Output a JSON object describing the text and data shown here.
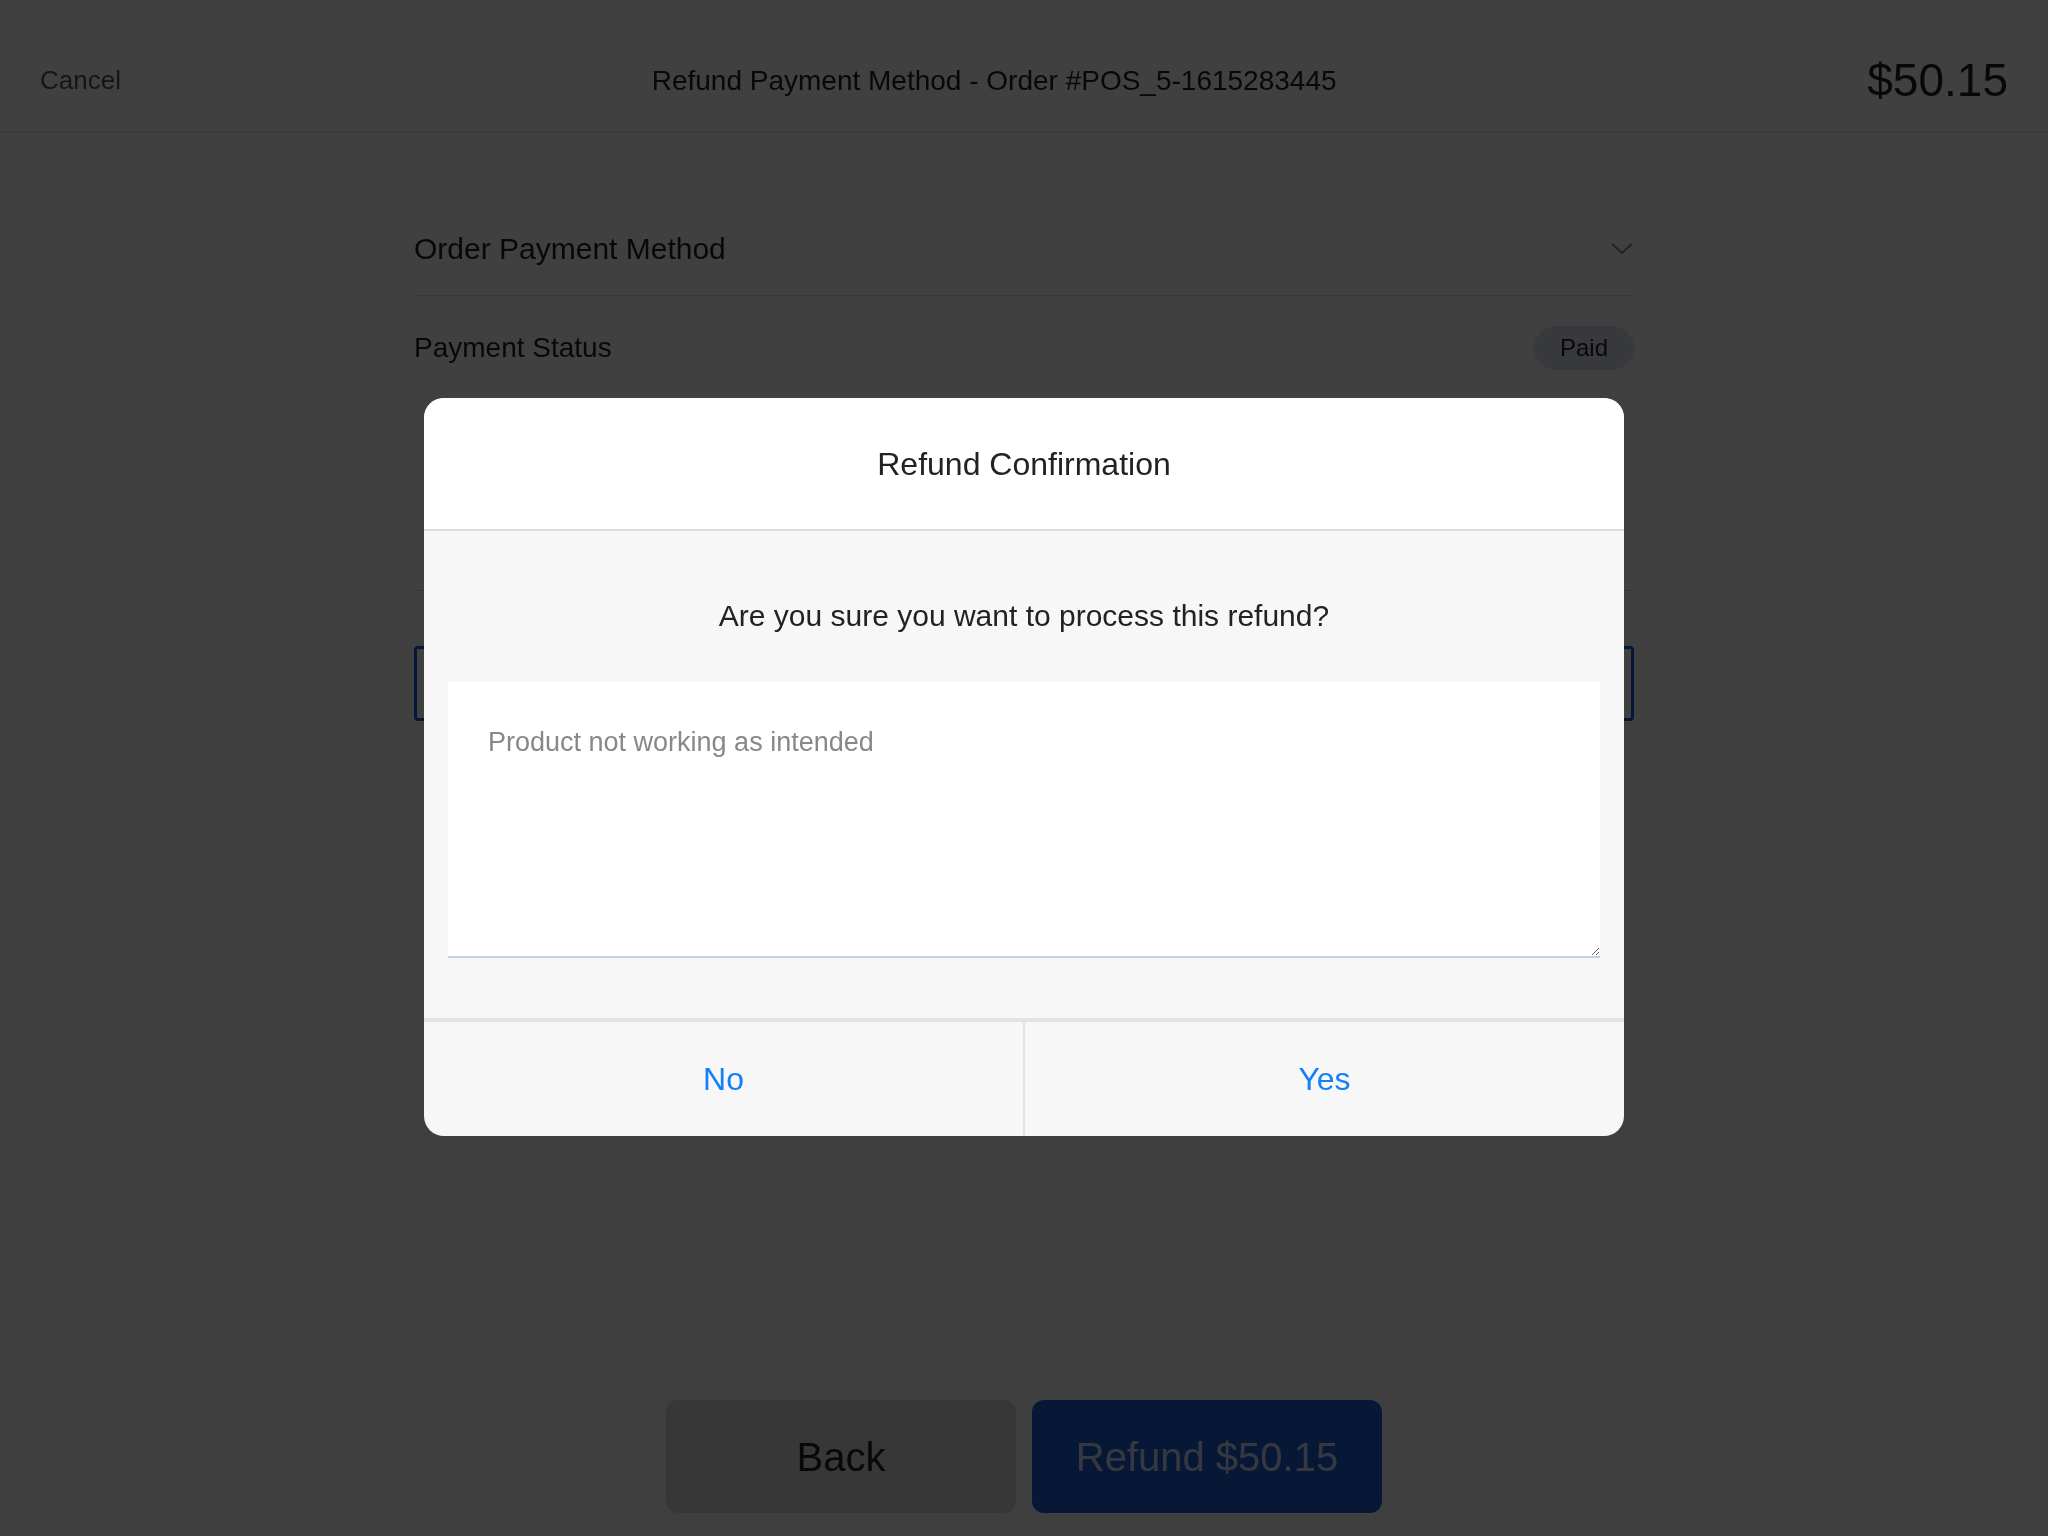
{
  "header": {
    "cancel": "Cancel",
    "title": "Refund Payment Method - Order #POS_5-1615283445",
    "total": "$50.15"
  },
  "order_card": {
    "title": "Order Payment Method",
    "expanded": true,
    "status_label": "Payment Status",
    "status_badge": "Paid"
  },
  "footer_buttons": [
    {
      "label": "Back",
      "kind": "secondary"
    },
    {
      "label": "Refund $50.15",
      "kind": "primary"
    }
  ],
  "dialog": {
    "title": "Refund Confirmation",
    "message": "Are you sure you want to process this refund?",
    "reason": {
      "placeholder": "Product not working as intended"
    },
    "buttons": [
      "No",
      "Yes"
    ]
  }
}
